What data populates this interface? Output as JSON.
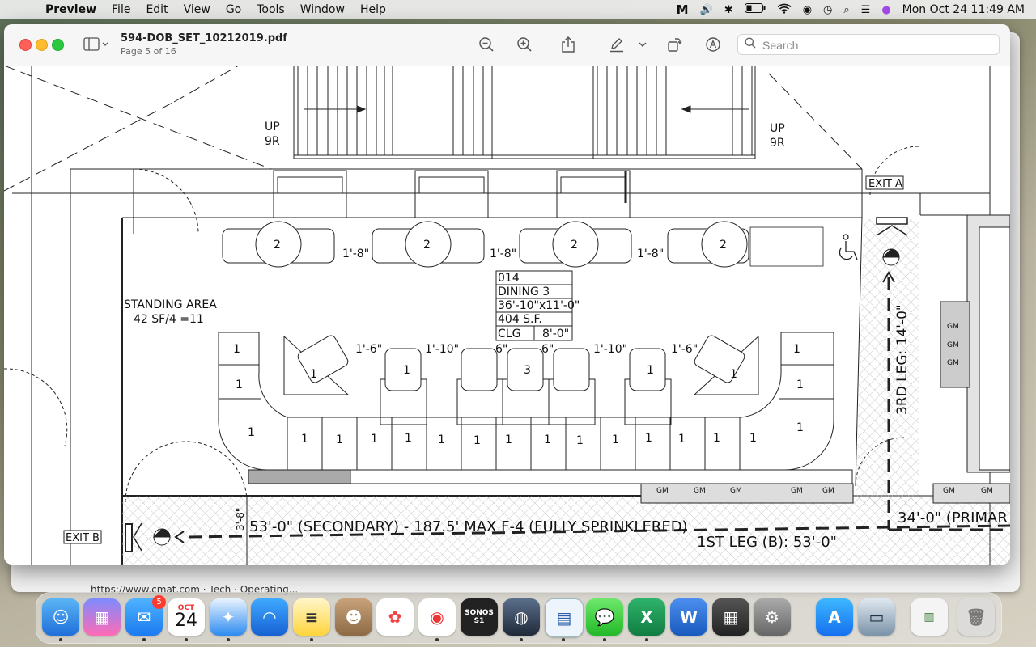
{
  "menubar": {
    "app": "Preview",
    "items": [
      "File",
      "Edit",
      "View",
      "Go",
      "Tools",
      "Window",
      "Help"
    ],
    "clock": "Mon Oct 24  11:49 AM"
  },
  "window": {
    "title": "594-DOB_SET_10212019.pdf",
    "subtitle": "Page 5 of 16",
    "search_placeholder": "Search"
  },
  "drawing": {
    "up_left": "UP",
    "risers_left": "9R",
    "up_right": "UP",
    "risers_right": "9R",
    "exit_a": "EXIT A",
    "exit_b": "EXIT B",
    "standing_area": "STANDING AREA",
    "standing_calc": "42 SF/4 =11",
    "room_label": [
      "014",
      "DINING 3",
      "36'-10\"x11'-0\"",
      "404 S.F."
    ],
    "clg_label": "CLG",
    "clg_value": "8'-0\"",
    "table_seats_top": [
      "2",
      "2",
      "2",
      "2"
    ],
    "clear_top": [
      "1'-8\"",
      "1'-8\"",
      "1'-8\""
    ],
    "clear_mid": [
      "1'-6\"",
      "1'-10\"",
      "6\"",
      "6\"",
      "1'-10\"",
      "1'-6\""
    ],
    "seat_single": "1",
    "seat_three": "3",
    "leg3": "3RD LEG: 14'-0\"",
    "secondary": "53'-0\" (SECONDARY) - 187.5' MAX F-4 (FULLY SPRINKLERED)",
    "leg1": "1ST LEG (B): 53'-0\"",
    "primary": "34'-0\" (PRIMAR",
    "dim_38": "3'-8\"",
    "gm": "GM"
  },
  "background": {
    "url_text": "https://www.cmat.com · Tech · Operating..."
  },
  "dock": {
    "mail_badge": "5",
    "calendar_month": "OCT",
    "calendar_day": "24",
    "sonos_label": "SONOS",
    "sonos_sub": "S1"
  }
}
